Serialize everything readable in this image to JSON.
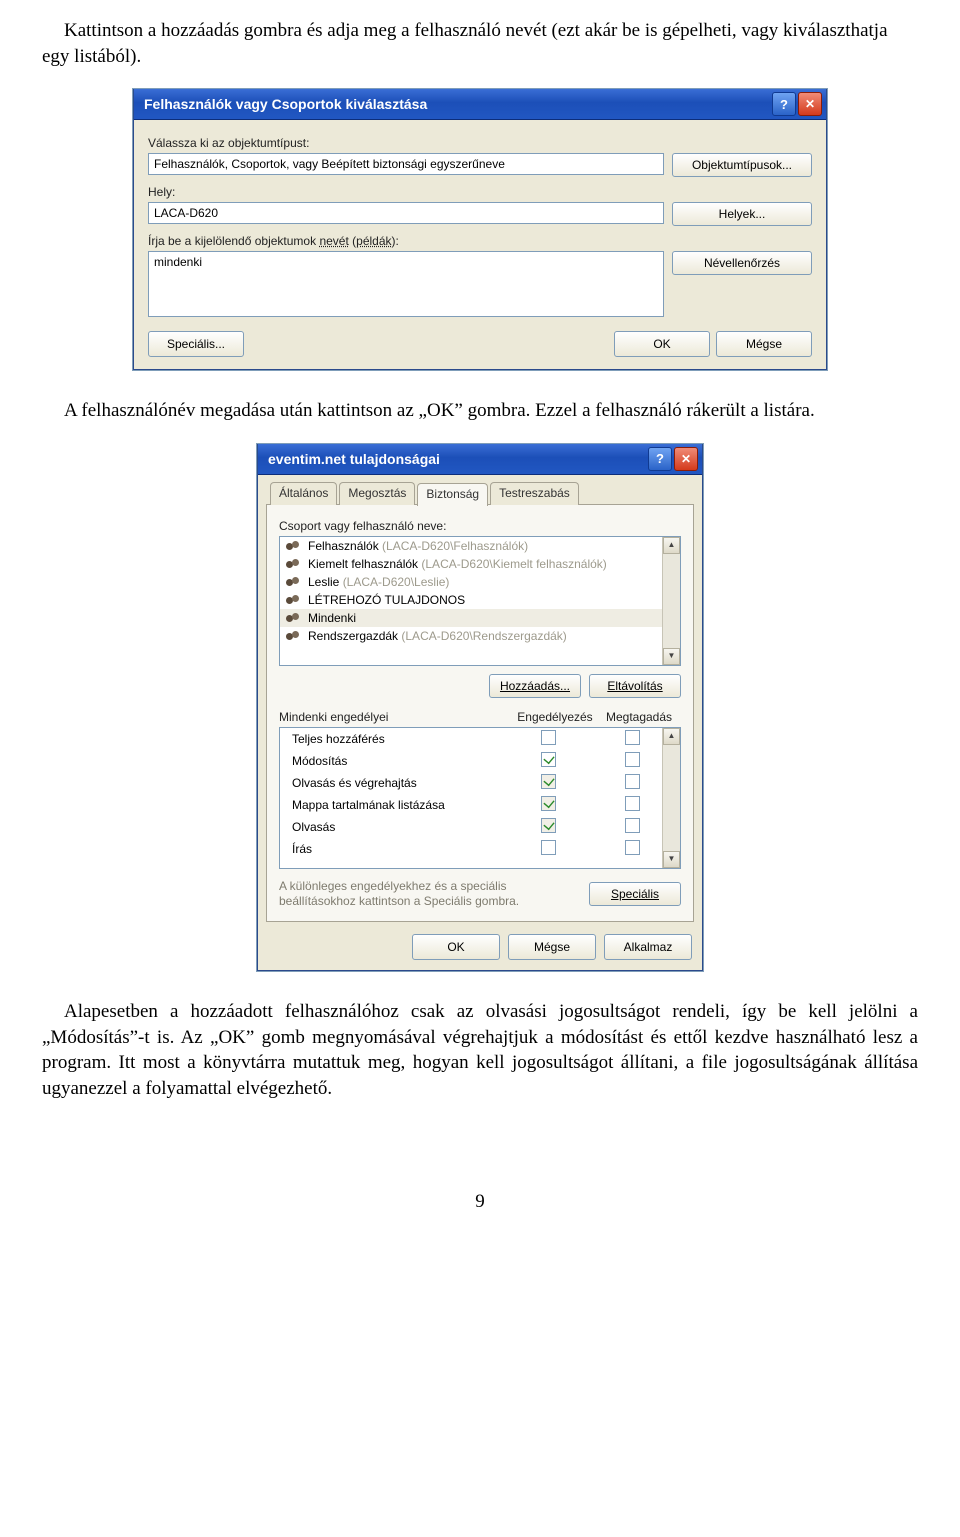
{
  "para1": "Kattintson a hozzáadás gombra és adja meg a felhasználó nevét (ezt akár be is gépelheti, vagy kiválaszthatja egy listából).",
  "para2": "A felhasználónév megadása után kattintson az „OK” gombra. Ezzel a felhasználó rákerült a listára.",
  "para3": "Alapesetben a hozzáadott felhasználóhoz csak az olvasási jogosultságot rendeli, így be kell jelölni a „Módosítás”-t is. Az „OK” gomb megnyomásával végrehajtjuk a módosítást és ettől kezdve használható lesz a program. Itt most a könyvtárra mutattuk meg, hogyan kell jogosultságot állítani, a file jogosultságának állítása ugyanezzel a folyamattal elvégezhető.",
  "page_number": "9",
  "dlg1": {
    "title": "Felhasználók vagy Csoportok kiválasztása",
    "lbl_object_type": "Válassza ki az objektumtípust:",
    "val_object_type": "Felhasználók, Csoportok, vagy Beépített biztonsági egyszerűneve",
    "btn_object_types": "Objektumtípusok...",
    "lbl_location": "Hely:",
    "val_location": "LACA-D620",
    "btn_locations": "Helyek...",
    "lbl_names_a": "Írja be a kijelölendő objektumok ",
    "lbl_names_b": "nevét",
    "lbl_names_c": " (",
    "lbl_names_d": "példák",
    "lbl_names_e": "):",
    "val_names": "mindenki",
    "btn_check": "Névellenőrzés",
    "btn_advanced": "Speciális...",
    "btn_ok": "OK",
    "btn_cancel": "Mégse"
  },
  "dlg2": {
    "title": "eventim.net tulajdonságai",
    "tabs": {
      "general": "Általános",
      "sharing": "Megosztás",
      "security": "Biztonság",
      "custom": "Testreszabás"
    },
    "lbl_group_user": "Csoport vagy felhasználó neve:",
    "users": [
      "Felhasználók (LACA-D620\\Felhasználók)",
      "Kiemelt felhasználók (LACA-D620\\Kiemelt felhasználók)",
      "Leslie (LACA-D620\\Leslie)",
      "LÉTREHOZÓ TULAJDONOS",
      "Mindenki",
      "Rendszergazdák (LACA-D620\\Rendszergazdák)"
    ],
    "btn_add": "Hozzáadás...",
    "btn_remove": "Eltávolítás",
    "perm_header": "Mindenki engedélyei",
    "col_allow": "Engedélyezés",
    "col_deny": "Megtagadás",
    "perms": [
      {
        "name": "Teljes hozzáférés",
        "allow": false,
        "deny": false
      },
      {
        "name": "Módosítás",
        "allow": true,
        "deny": false
      },
      {
        "name": "Olvasás és végrehajtás",
        "allow": true,
        "deny": false
      },
      {
        "name": "Mappa tartalmának listázása",
        "allow": true,
        "deny": false
      },
      {
        "name": "Olvasás",
        "allow": true,
        "deny": false
      },
      {
        "name": "Írás",
        "allow": false,
        "deny": false
      }
    ],
    "note": "A különleges engedélyekhez és a speciális beállításokhoz kattintson a Speciális gombra.",
    "btn_special": "Speciális",
    "btn_ok": "OK",
    "btn_cancel": "Mégse",
    "btn_apply": "Alkalmaz"
  }
}
